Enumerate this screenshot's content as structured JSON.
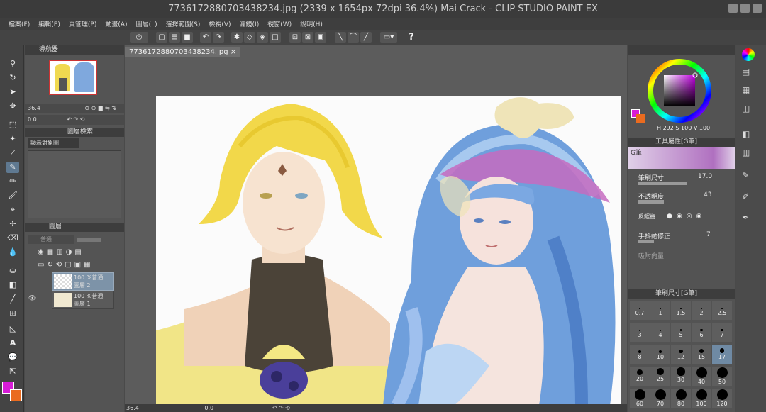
{
  "window": {
    "title": "7736172880703438234.jpg (2339 x 1654px 72dpi 36.4%)   Mai Crack - CLIP STUDIO PAINT EX"
  },
  "menu": [
    "檔案(F)",
    "編輯(E)",
    "頁管理(P)",
    "動畫(A)",
    "圖層(L)",
    "選擇範圍(S)",
    "檢視(V)",
    "濾鏡(I)",
    "視窗(W)",
    "說明(H)"
  ],
  "document_tab": {
    "label": "7736172880703438234.jpg"
  },
  "navigator": {
    "tab_label": "導航器",
    "zoom": "36.4",
    "angle": "0.0"
  },
  "layer_search": {
    "tab_label": "圖層檢索",
    "filter_label": "顯示對象圖"
  },
  "layers_panel": {
    "tab_label": "圖層",
    "blend_mode": "普通",
    "layers": [
      {
        "opacity_mode": "100 %普通",
        "name": "圖層 2"
      },
      {
        "opacity_mode": "100 %普通",
        "name": "圖層 1"
      }
    ]
  },
  "color": {
    "main_hex": "#d81cd8",
    "sub_hex": "#ea6b1f",
    "h": "292",
    "s": "100",
    "v": "100"
  },
  "tool_property": {
    "tab_label": "工具屬性[G筆]",
    "tool_name": "G筆",
    "brush_size_label": "筆刷尺寸",
    "brush_size_value": "17.0",
    "opacity_label": "不透明度",
    "opacity_value": "43",
    "anti_alias_label": "反鋸齒",
    "stabilization_label": "手抖動修正",
    "stabilization_value": "7",
    "vector_snap_label": "吸附向量"
  },
  "brush_size_panel": {
    "tab_label": "筆刷尺寸[G筆]",
    "sizes": [
      "0.7",
      "1",
      "1.5",
      "2",
      "2.5",
      "3",
      "4",
      "5",
      "6",
      "7",
      "8",
      "10",
      "12",
      "15",
      "17",
      "20",
      "25",
      "30",
      "40",
      "50",
      "60",
      "70",
      "80",
      "100",
      "120"
    ]
  },
  "status": {
    "zoom": "36.4",
    "angle": "0.0"
  }
}
